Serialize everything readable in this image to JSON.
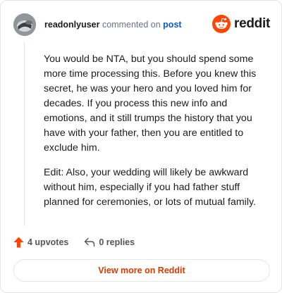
{
  "header": {
    "username": "readonlyuser",
    "action": "commented on",
    "post_link": "post",
    "brand": "reddit"
  },
  "comment": {
    "paragraphs": [
      "You would be NTA, but you should spend some more time processing this. Before you knew this secret, he was your hero and you loved him for decades. If you process this new info and emotions, and it still trumps the history that you have with your father, then you are entitled to exclude him.",
      "Edit: Also, your wedding will likely be awkward without him, especially if you had father stuff planned for ceremonies, or lots of mutual family."
    ]
  },
  "footer": {
    "upvotes": "4 upvotes",
    "replies": "0 replies"
  },
  "cta": {
    "label": "View more on Reddit"
  },
  "colors": {
    "accent": "#ff4500",
    "link": "#0a58ca",
    "cta": "#d93a00"
  },
  "icons": {
    "avatar": "avatar",
    "brand": "reddit-logo-icon",
    "upvote": "upvote-arrow-icon",
    "reply": "reply-icon"
  }
}
